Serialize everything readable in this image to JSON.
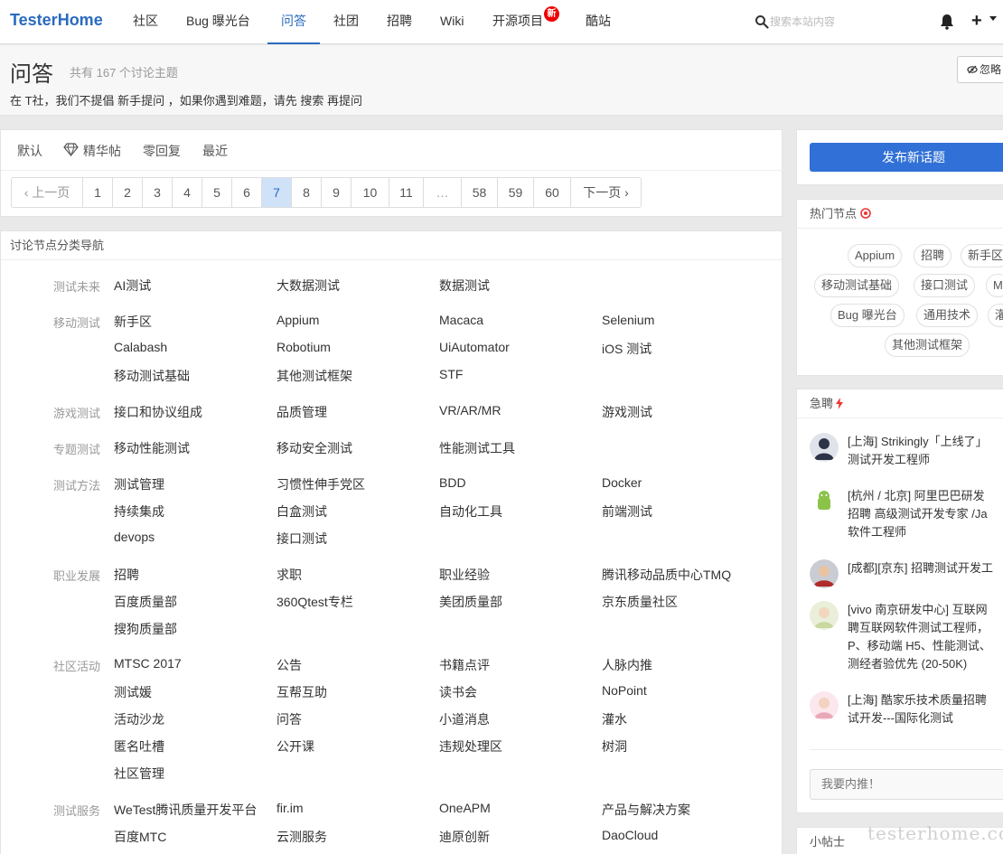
{
  "nav": {
    "brand": "TesterHome",
    "items": [
      "社区",
      "Bug 曝光台",
      "问答",
      "社团",
      "招聘",
      "Wiki",
      "开源项目",
      "酷站"
    ],
    "active": "问答",
    "new_badge": "新",
    "search_placeholder": "搜索本站内容",
    "plus": "+"
  },
  "header": {
    "title": "问答",
    "count": "共有 167 个讨论主题",
    "desc": "在 T社，我们不提倡 新手提问 ，如果你遇到难题，请先 搜索 再提问",
    "ignore_button": "忽略"
  },
  "filters": {
    "default": "默认",
    "excellent": "精华帖",
    "no_reply": "零回复",
    "latest": "最近"
  },
  "pagination": {
    "prev": "‹ 上一页",
    "pages": [
      "1",
      "2",
      "3",
      "4",
      "5",
      "6",
      "7",
      "8",
      "9",
      "10",
      "11",
      "…",
      "58",
      "59",
      "60"
    ],
    "current": "7",
    "next": "下一页 ›"
  },
  "categories": {
    "heading": "讨论节点分类导航",
    "groups": [
      {
        "label": "测试未来",
        "links": [
          "AI测试",
          "大数据测试",
          "数据测试"
        ]
      },
      {
        "label": "移动测试",
        "links": [
          "新手区",
          "Appium",
          "Macaca",
          "Selenium",
          "Calabash",
          "Robotium",
          "UiAutomator",
          "iOS 测试",
          "移动测试基础",
          "其他测试框架",
          "STF"
        ]
      },
      {
        "label": "游戏测试",
        "links": [
          "接口和协议组成",
          "品质管理",
          "VR/AR/MR",
          "游戏测试"
        ]
      },
      {
        "label": "专题测试",
        "links": [
          "移动性能测试",
          "移动安全测试",
          "性能测试工具"
        ]
      },
      {
        "label": "测试方法",
        "links": [
          "测试管理",
          "习惯性伸手党区",
          "BDD",
          "Docker",
          "持续集成",
          "白盒测试",
          "自动化工具",
          "前端测试",
          "devops",
          "接口测试"
        ]
      },
      {
        "label": "职业发展",
        "links": [
          "招聘",
          "求职",
          "职业经验",
          "腾讯移动品质中心TMQ",
          "百度质量部",
          "360Qtest专栏",
          "美团质量部",
          "京东质量社区",
          "搜狗质量部"
        ]
      },
      {
        "label": "社区活动",
        "links": [
          "MTSC 2017",
          "公告",
          "书籍点评",
          "人脉内推",
          "测试媛",
          "互帮互助",
          "读书会",
          "NoPoint",
          "活动沙龙",
          "问答",
          "小道消息",
          "灌水",
          "匿名吐槽",
          "公开课",
          "违规处理区",
          "树洞",
          "社区管理"
        ]
      },
      {
        "label": "测试服务",
        "links": [
          "WeTest腾讯质量开发平台",
          "fir.im",
          "OneAPM",
          "产品与解决方案",
          "百度MTC",
          "云测服务",
          "迪原创新",
          "DaoCloud"
        ]
      }
    ]
  },
  "sidebar": {
    "publish_button": "发布新话题",
    "hot_nodes_title": "热门节点",
    "hot_nodes": [
      "Appium",
      "招聘",
      "新手区",
      "移动测试基础",
      "接口测试",
      "M",
      "Bug 曝光台",
      "通用技术",
      "灌",
      "其他测试框架"
    ],
    "jobs_title": "急聘",
    "jobs": [
      {
        "lines": [
          "[上海] Strikingly「上线了」",
          "测试开发工程师"
        ]
      },
      {
        "lines": [
          "[杭州 / 北京] 阿里巴巴研发",
          "招聘 高级测试开发专家 /Ja",
          "软件工程师"
        ]
      },
      {
        "lines": [
          "[成都][京东] 招聘测试开发工"
        ]
      },
      {
        "lines": [
          "[vivo 南京研发中心] 互联网",
          "聘互联网软件测试工程师，",
          "P、移动端 H5、性能测试、",
          "测经者验优先 (20-50K)"
        ]
      },
      {
        "lines": [
          "[上海] 酷家乐技术质量招聘",
          "试开发---国际化测试"
        ]
      }
    ],
    "refer_input": "我要内推！",
    "tips_title": "小帖士"
  },
  "watermark": "testerhome.com",
  "colors": {
    "brand": "#2a6bbf",
    "publish": "#3170d6",
    "badge": "#e00000"
  }
}
